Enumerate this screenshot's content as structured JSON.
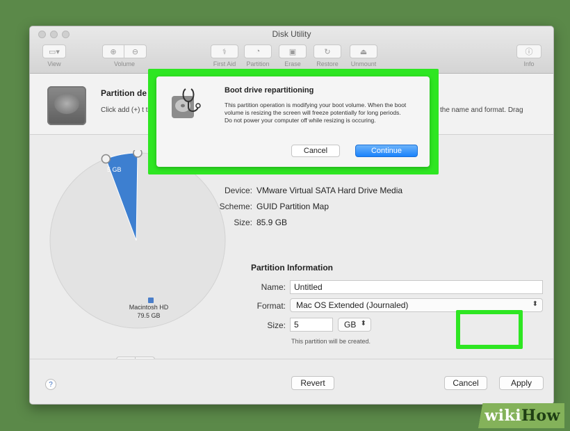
{
  "window": {
    "title": "Disk Utility"
  },
  "toolbar": {
    "view_label": "View",
    "volume_label": "Volume",
    "first_aid_label": "First Aid",
    "partition_label": "Partition",
    "erase_label": "Erase",
    "restore_label": "Restore",
    "unmount_label": "Unmount",
    "info_label": "Info"
  },
  "header": {
    "title": "Partition de",
    "description": "Click add (+) t the resize con",
    "description_right": "the name and format. Drag"
  },
  "pie": {
    "slice_small_label": "5 GB",
    "slice_small_fraction": 0.059,
    "slice_large_name": "Macintosh HD",
    "slice_large_size": "79.5 GB",
    "colors": {
      "small": "#3d7fd0",
      "large": "#e3e3e3"
    }
  },
  "pm_buttons": {
    "add": "+",
    "remove": "−"
  },
  "device_info": {
    "device_key": "Device:",
    "device_val": "VMware Virtual SATA Hard Drive Media",
    "scheme_key": "Scheme:",
    "scheme_val": "GUID Partition Map",
    "size_key": "Size:",
    "size_val": "85.9 GB"
  },
  "partition_info": {
    "title": "Partition Information",
    "name_key": "Name:",
    "name_value": "Untitled",
    "format_key": "Format:",
    "format_value": "Mac OS Extended (Journaled)",
    "size_key": "Size:",
    "size_value": "5",
    "size_unit": "GB",
    "note": "This partition will be created."
  },
  "bottom": {
    "help": "?",
    "revert": "Revert",
    "cancel": "Cancel",
    "apply": "Apply"
  },
  "dialog": {
    "title": "Boot drive repartitioning",
    "body": "This partition operation is modifying your boot volume. When the boot volume is resizing the screen will freeze potentially for long periods. Do not power your computer off while resizing is occuring.",
    "cancel": "Cancel",
    "continue": "Continue"
  },
  "watermark": {
    "wiki": "wiki",
    "how": "How"
  },
  "colors": {
    "highlight": "#2ee622",
    "accent": "#1a82fb"
  }
}
